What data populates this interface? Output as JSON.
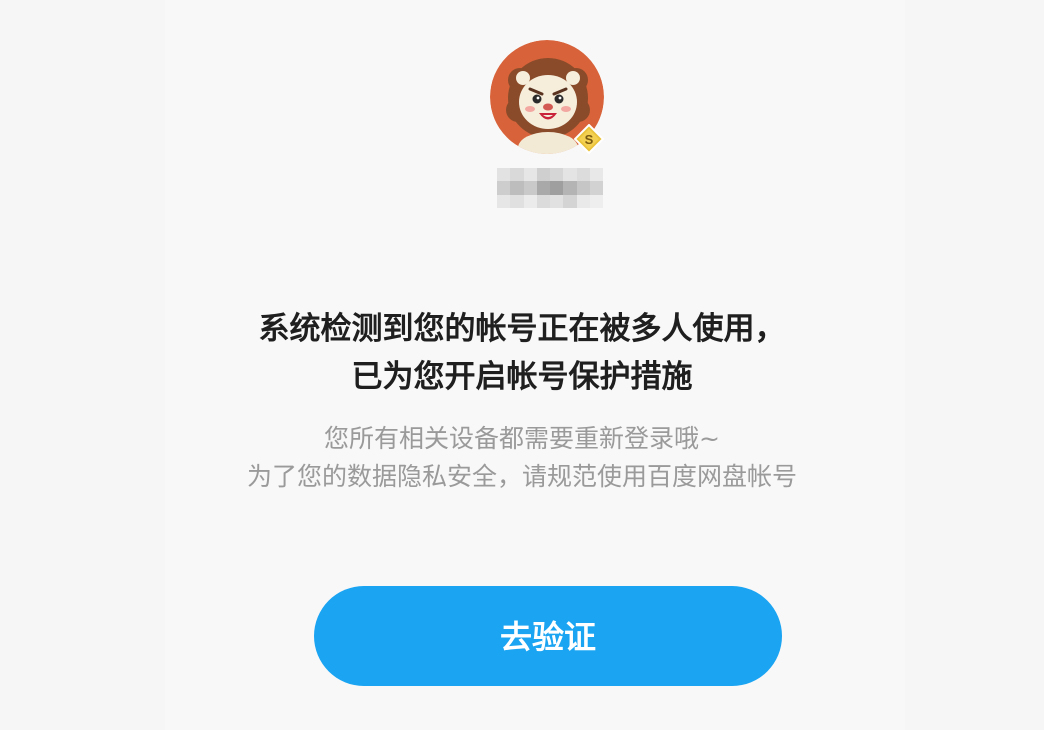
{
  "profile": {
    "avatar_icon": "lion-mascot-avatar-icon",
    "badge_icon": "svip-s-badge-icon",
    "badge_letter": "S",
    "colors": {
      "avatar_bg": "#d8633a",
      "badge": "#e9c23a"
    }
  },
  "message": {
    "headline_line1": "系统检测到您的帐号正在被多人使用，",
    "headline_line2": "已为您开启帐号保护措施",
    "sub_line1": "您所有相关设备都需要重新登录哦~",
    "sub_line2": "为了您的数据隐私安全，请规范使用百度网盘帐号"
  },
  "action": {
    "verify_label": "去验证",
    "color": "#1aa4f2"
  }
}
